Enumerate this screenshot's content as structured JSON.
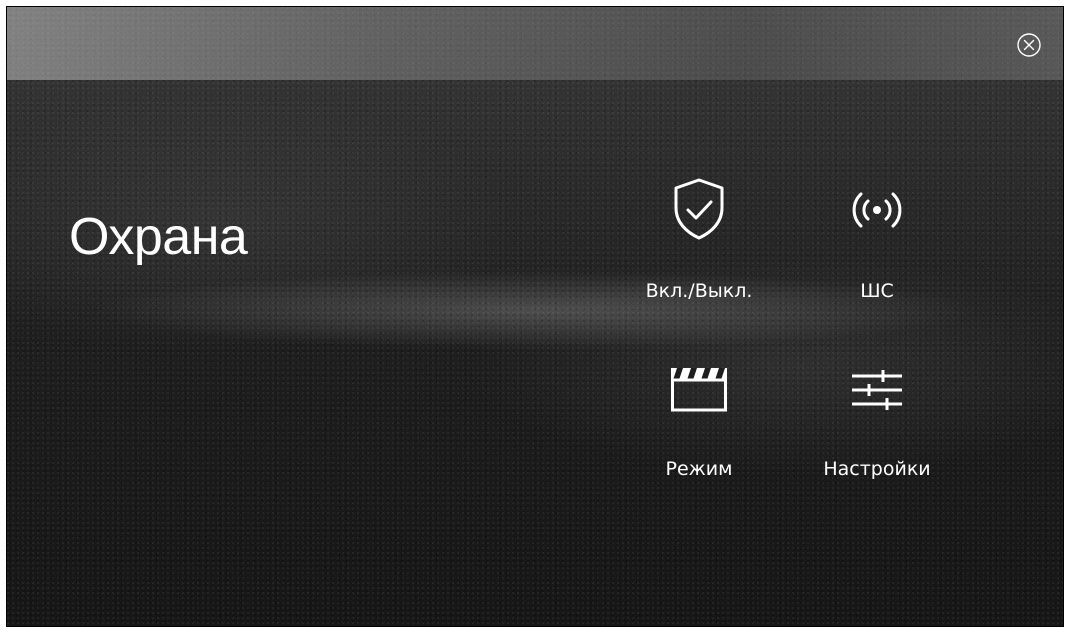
{
  "page": {
    "title": "Охрана"
  },
  "window": {
    "close_icon": "close-circle-icon"
  },
  "tiles": [
    {
      "label": "Вкл./Выкл.",
      "icon": "shield-check-icon"
    },
    {
      "label": "ШС",
      "icon": "wireless-signal-icon"
    },
    {
      "label": "Режим",
      "icon": "clapperboard-icon"
    },
    {
      "label": "Настройки",
      "icon": "sliders-icon"
    }
  ],
  "colors": {
    "text": "#ffffff",
    "background": "#1e1e1e"
  }
}
